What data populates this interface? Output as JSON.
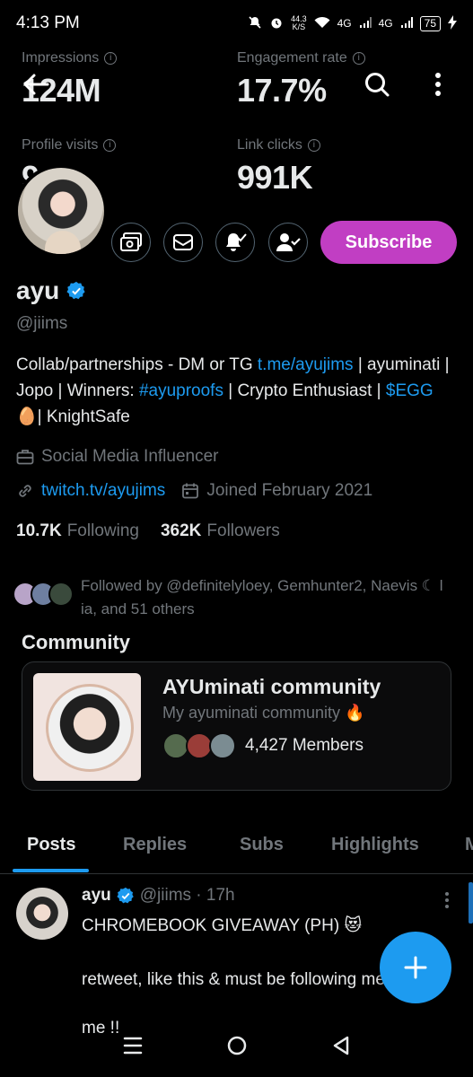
{
  "status_bar": {
    "time": "4:13 PM",
    "net_speed": "44.3",
    "net_unit": "K/S",
    "signal_1": "4G",
    "signal_2": "4G",
    "battery": "75"
  },
  "stats": {
    "impressions": {
      "label": "Impressions",
      "value": "124M"
    },
    "engagement": {
      "label": "Engagement rate",
      "value": "17.7%"
    },
    "profile_visits": {
      "label": "Profile visits",
      "value": "9"
    },
    "link_clicks": {
      "label": "Link clicks",
      "value": "991K"
    }
  },
  "actions": {
    "subscribe_label": "Subscribe"
  },
  "profile": {
    "name": "ayu",
    "handle": "@jiims",
    "bio_1": "Collab/partnerships - DM or TG ",
    "bio_link_1": "t.me/ayujims",
    "bio_2": " | ayuminati | Jopo | Winners: ",
    "bio_link_2": "#ayuproofs",
    "bio_3": " | Crypto Enthusiast | ",
    "bio_link_3": "$EGG",
    "bio_4": " 🥚| KnightSafe",
    "category": "Social Media Influencer",
    "website": "twitch.tv/ayujims",
    "joined": "Joined February 2021",
    "following_count": "10.7K",
    "following_label": "Following",
    "followers_count": "362K",
    "followers_label": "Followers",
    "followed_by": "Followed by @definitelyloey, Gemhunter2, Naevis ☾ l ia, and 51 others"
  },
  "community": {
    "section_title": "Community",
    "name": "AYUminati community",
    "description": "My ayuminati community 🔥",
    "members": "4,427 Members"
  },
  "tabs": [
    {
      "label": "Posts"
    },
    {
      "label": "Replies"
    },
    {
      "label": "Subs"
    },
    {
      "label": "Highlights"
    },
    {
      "label": "M"
    }
  ],
  "post": {
    "name": "ayu",
    "handle_time": "@jiims · 17h",
    "text": "CHROMEBOOK GIVEAWAY (PH) 😻\n\nretweet, like this & must be following me !!",
    "overflow_text": "me !!"
  },
  "colors": {
    "accent": "#1d9bf0",
    "subscribe": "#c13ec3",
    "muted": "#71767b",
    "background": "#000000"
  }
}
